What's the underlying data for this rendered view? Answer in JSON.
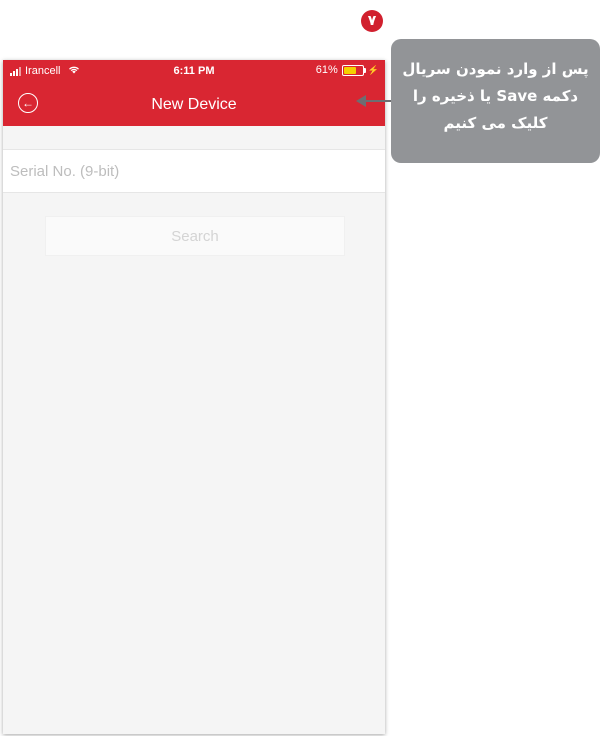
{
  "step_number": "۷",
  "status_bar": {
    "carrier": "Irancell",
    "time": "6:11 PM",
    "battery": "61%"
  },
  "nav": {
    "title": "New Device"
  },
  "serial_input": {
    "placeholder": "Serial No. (9-bit)",
    "value": ""
  },
  "search_button": {
    "label": "Search"
  },
  "callout": {
    "lines": [
      "پس از وارد نمودن سریال",
      "دکمه Save یا ذخیره را",
      "کلیک می کنیم"
    ]
  },
  "colors": {
    "header": "#d92632",
    "badge": "#d1202e",
    "callout": "#929497",
    "screen_background": "#f5f5f5"
  },
  "icons": {
    "back": "back-arrow-circle-icon",
    "signal": "signal-bars-icon",
    "wifi": "wifi-icon",
    "battery": "battery-icon",
    "charging": "charging-bolt-icon",
    "callout_arrow": "left-arrow-icon"
  }
}
